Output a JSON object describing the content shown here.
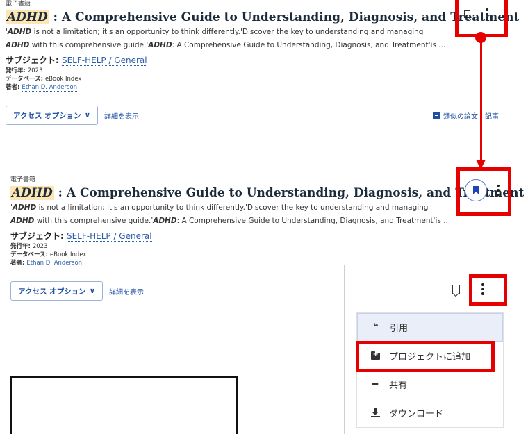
{
  "results": [
    {
      "type": "電子書籍",
      "title_hl": "ADHD",
      "title_rest": " : A Comprehensive Guide to Understanding, Diagnosis, and Treatment",
      "abstract_l1_q": "'",
      "abstract_l1_b": "ADHD",
      "abstract_l1_rest": " is not a limitation; it's an opportunity to think differently.'Discover the key to understanding and managing",
      "abstract_l2_b1": "ADHD",
      "abstract_l2_mid": " with this comprehensive guide.'",
      "abstract_l2_b2": "ADHD",
      "abstract_l2_rest": ": A Comprehensive Guide to Understanding, Diagnosis, and Treatment'is ...",
      "subject_label": "サブジェクト: ",
      "subject_value": "SELF-HELP / General",
      "year_label": "発行年: ",
      "year_value": "2023",
      "db_label": "データベース: ",
      "db_value": "eBook Index",
      "author_label": "著者: ",
      "author_value": "Ethan D. Anderson",
      "access_button": "アクセス オプション",
      "details_link": "詳細を表示",
      "similar_link": "類似の論文・記事"
    },
    {
      "type": "電子書籍",
      "title_hl": "ADHD",
      "title_rest": " : A Comprehensive Guide to Understanding, Diagnosis, and Treatment",
      "abstract_l1_q": "'",
      "abstract_l1_b": "ADHD",
      "abstract_l1_rest": " is not a limitation; it's an opportunity to think differently.'Discover the key to understanding and managing",
      "abstract_l2_b1": "ADHD",
      "abstract_l2_mid": " with this comprehensive guide.'",
      "abstract_l2_b2": "ADHD",
      "abstract_l2_rest": ": A Comprehensive Guide to Understanding, Diagnosis, and Treatment'is ...",
      "subject_label": "サブジェクト: ",
      "subject_value": "SELF-HELP / General",
      "year_label": "発行年: ",
      "year_value": "2023",
      "db_label": "データベース: ",
      "db_value": "eBook Index",
      "author_label": "著者: ",
      "author_value": "Ethan D. Anderson",
      "access_button": "アクセス オプション",
      "details_link": "詳細を表示"
    }
  ],
  "menu": {
    "items": [
      {
        "label": "引用",
        "icon": "quote-icon",
        "glyph": "❝"
      },
      {
        "label": "プロジェクトに追加",
        "icon": "folder-add-icon"
      },
      {
        "label": "共有",
        "icon": "share-icon",
        "glyph": "➦"
      },
      {
        "label": "ダウンロード",
        "icon": "download-icon"
      }
    ]
  },
  "colors": {
    "highlight": "#e60000",
    "link": "#1f4fa1",
    "title_highlight_bg": "#fde6b3"
  }
}
